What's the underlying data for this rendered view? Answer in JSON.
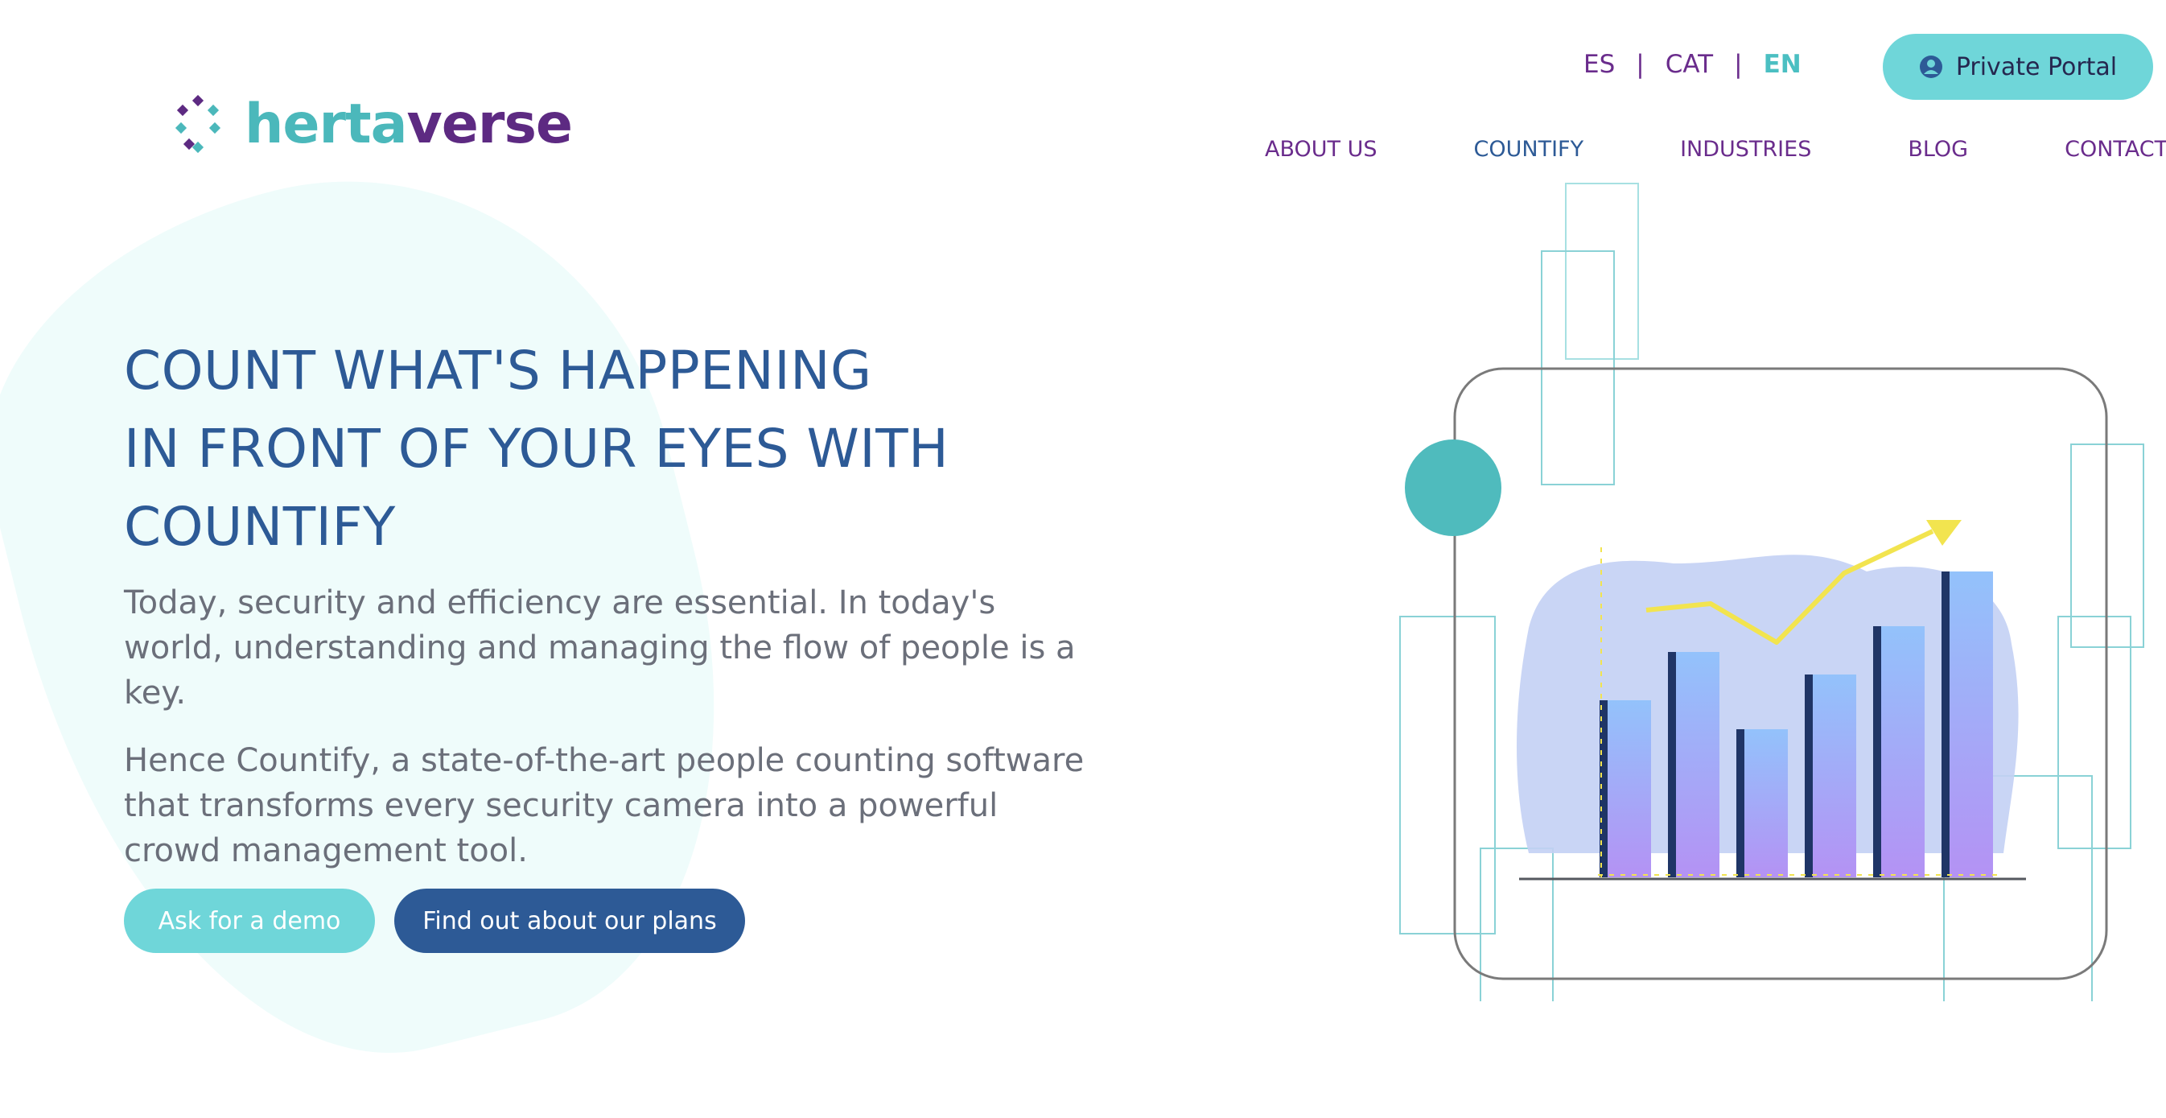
{
  "brand": {
    "name_part1": "herta",
    "name_part2": "verse",
    "mark_icon": "hertaverse-snowflake-logo-icon"
  },
  "languages": {
    "items": [
      "ES",
      "CAT",
      "EN"
    ],
    "separator": "|",
    "active": "EN"
  },
  "portal": {
    "label": "Private Portal",
    "icon": "user-circle-icon"
  },
  "nav": {
    "items": [
      "ABOUT US",
      "COUNTIFY",
      "INDUSTRIES",
      "BLOG",
      "CONTACT"
    ],
    "current": "COUNTIFY"
  },
  "hero": {
    "title_lines": [
      "COUNT WHAT'S HAPPENING",
      "IN FRONT OF YOUR EYES WITH",
      "COUNTIFY"
    ],
    "paragraph1": "Today, security and efficiency are essential. In today's world, understanding and managing the flow of people is a key.",
    "paragraph2": "Hence Countify, a state-of-the-art people counting software that transforms every security camera into a powerful crowd management tool."
  },
  "buttons": {
    "demo": "Ask for a demo",
    "plans": "Find out about our plans"
  },
  "colors": {
    "teal": "#6fd6d9",
    "teal_dark": "#4bb8bb",
    "purple": "#5d2a82",
    "navy": "#2d5a96",
    "body_text": "#6b6f7a",
    "hero_blob": "#effcfb"
  },
  "illustration": {
    "icon": "bar-chart-trend-illustration",
    "bar_levels": [
      0.55,
      0.7,
      0.46,
      0.63,
      0.78,
      0.95
    ]
  }
}
